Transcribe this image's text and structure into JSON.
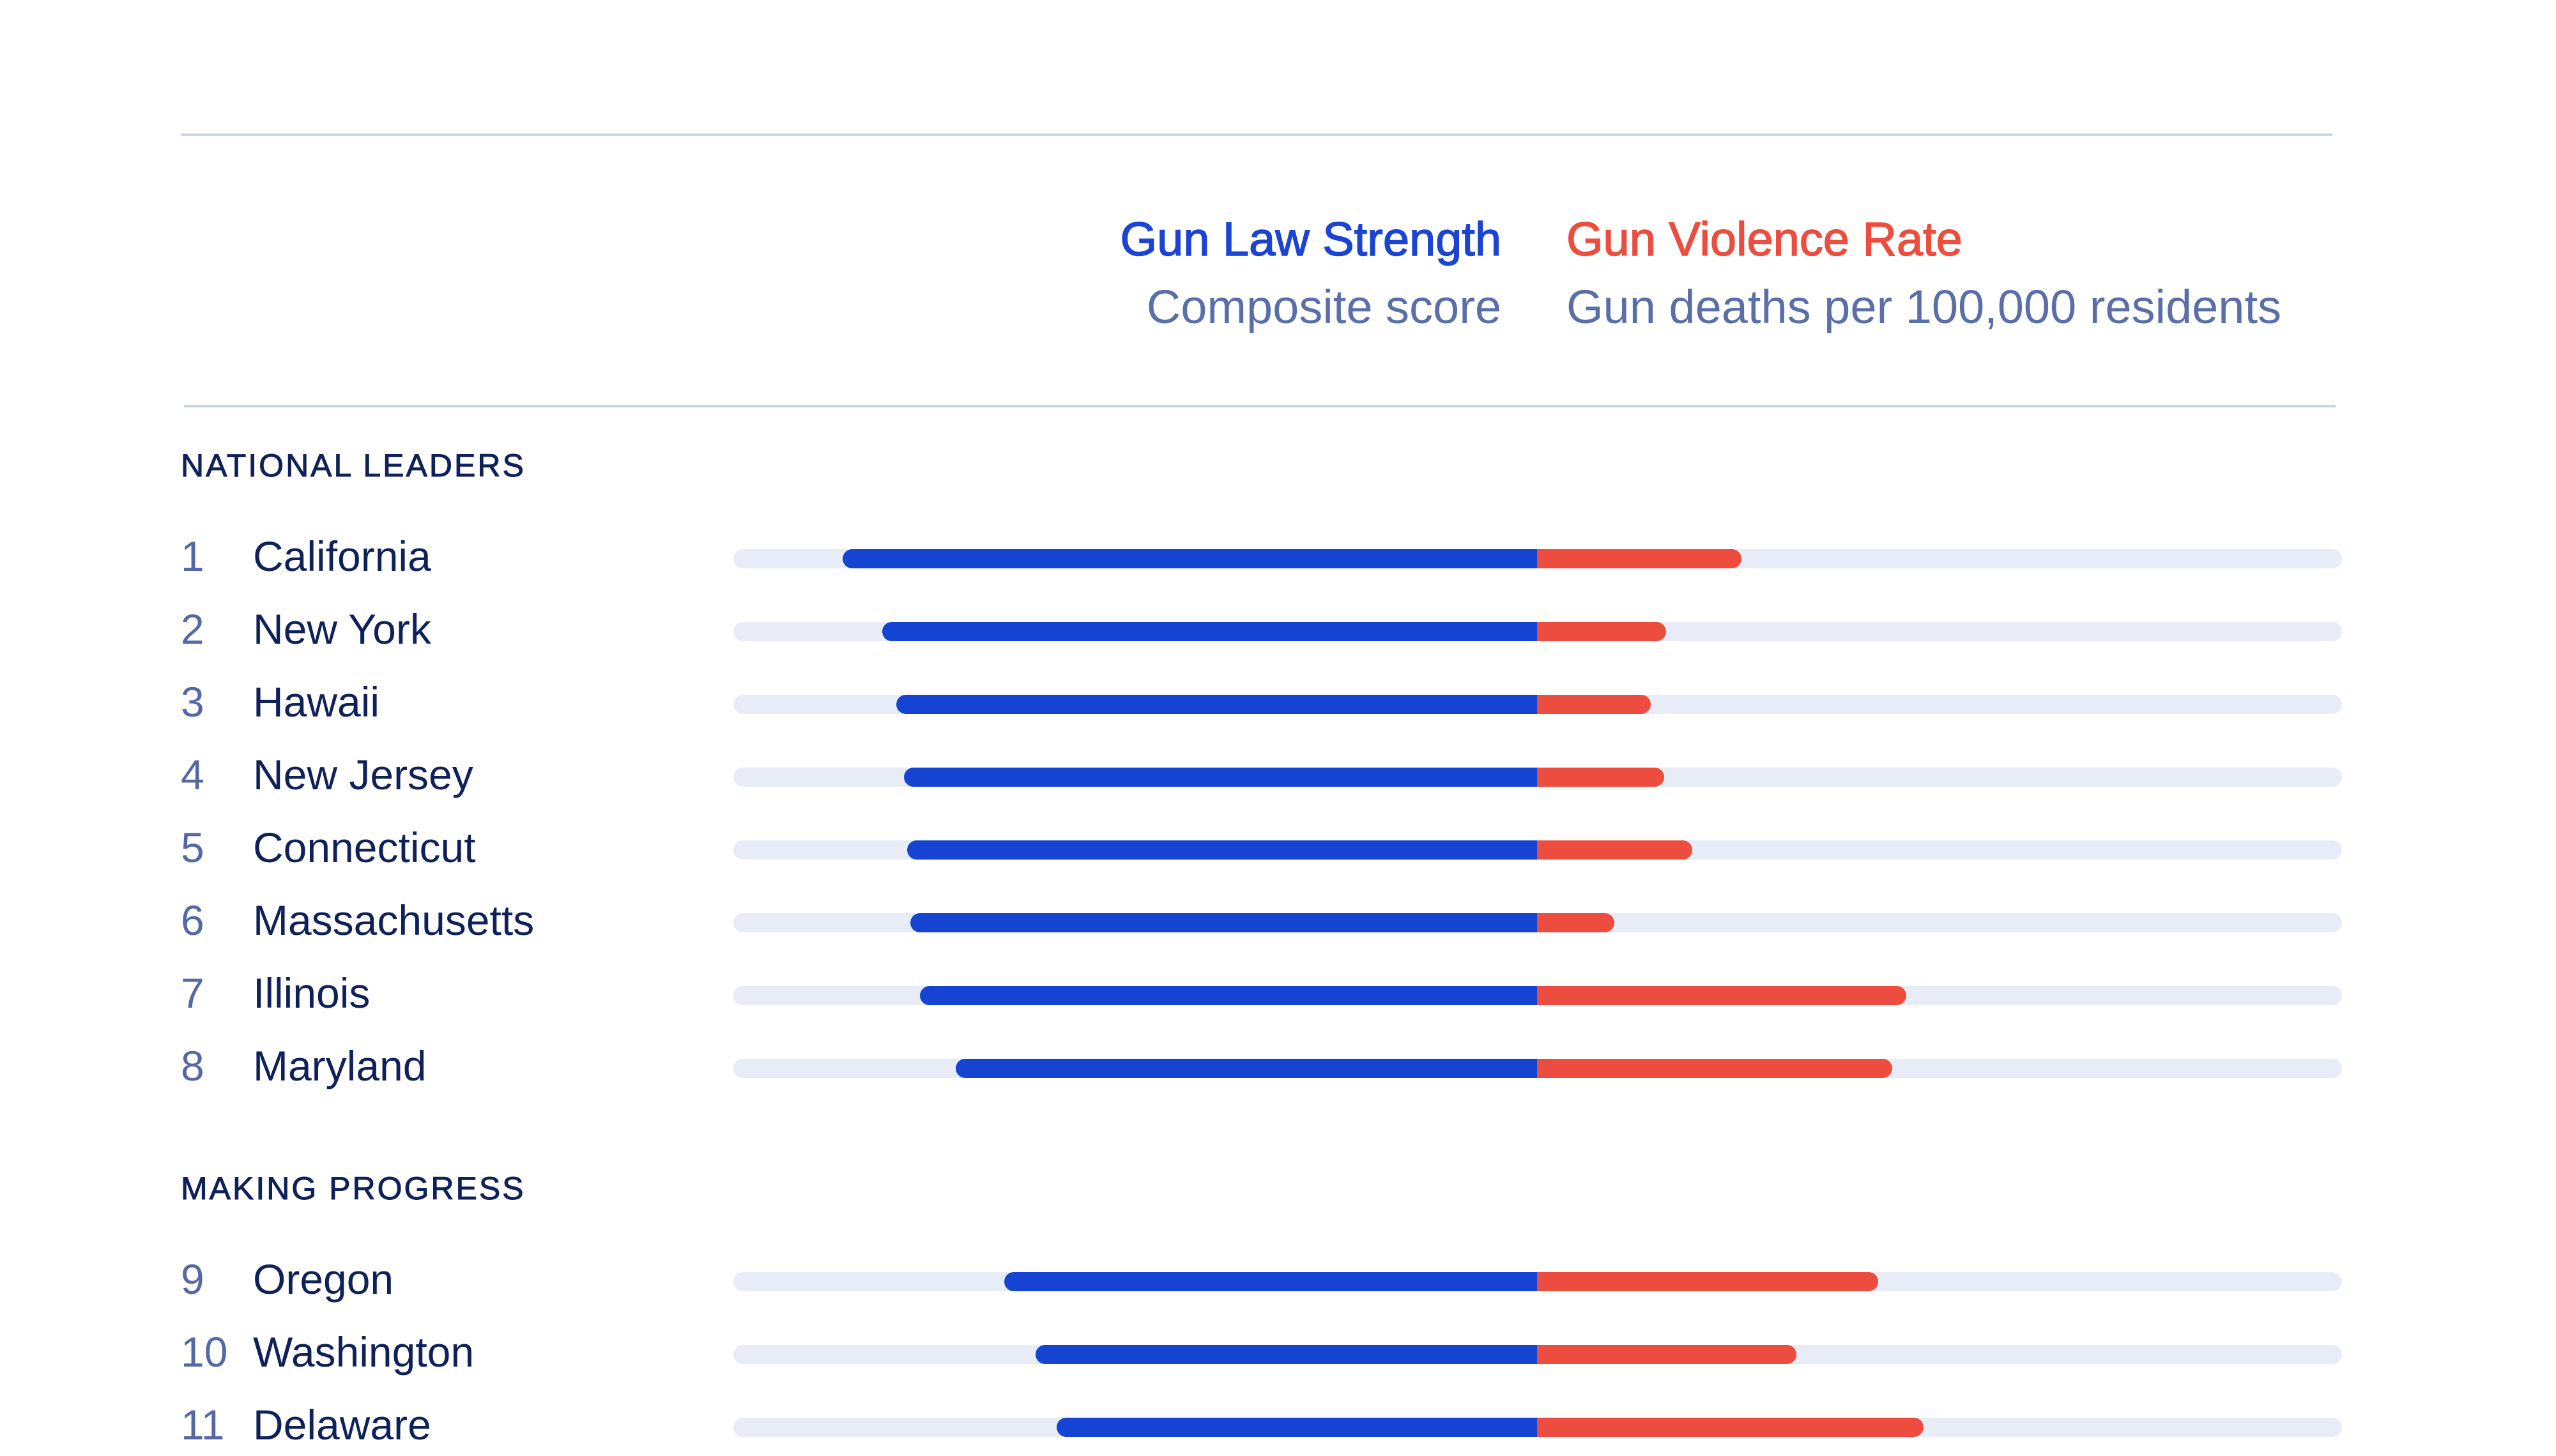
{
  "chart_data": {
    "type": "bar",
    "orientation": "horizontal-diverging",
    "title": "",
    "series": [
      {
        "name": "Gun Law Strength",
        "subtitle": "Composite score",
        "color": "#1544d3",
        "direction": "left",
        "values": [
          0.864,
          0.815,
          0.797,
          0.788,
          0.784,
          0.78,
          0.768,
          0.723,
          0.663,
          0.624,
          0.598
        ],
        "unit": "fraction of max (estimated, no axis shown)"
      },
      {
        "name": "Gun Violence Rate",
        "subtitle": "Gun deaths per 100,000 residents",
        "color": "#ec4d3e",
        "direction": "right",
        "values": [
          0.254,
          0.16,
          0.141,
          0.158,
          0.193,
          0.096,
          0.459,
          0.441,
          0.424,
          0.322,
          0.48
        ],
        "unit": "fraction of max (estimated, no axis shown)"
      }
    ],
    "groups": [
      {
        "label": "NATIONAL LEADERS",
        "rows": [
          {
            "rank": "1",
            "state": "California"
          },
          {
            "rank": "2",
            "state": "New York"
          },
          {
            "rank": "3",
            "state": "Hawaii"
          },
          {
            "rank": "4",
            "state": "New Jersey"
          },
          {
            "rank": "5",
            "state": "Connecticut"
          },
          {
            "rank": "6",
            "state": "Massachusetts"
          },
          {
            "rank": "7",
            "state": "Illinois"
          },
          {
            "rank": "8",
            "state": "Maryland"
          }
        ]
      },
      {
        "label": "MAKING PROGRESS",
        "rows": [
          {
            "rank": "9",
            "state": "Oregon"
          },
          {
            "rank": "10",
            "state": "Washington"
          },
          {
            "rank": "11",
            "state": "Delaware"
          }
        ]
      }
    ],
    "xlabel": "",
    "ylabel": "",
    "grid": false,
    "legend": "top-center"
  },
  "header": {
    "left_title": "Gun Law Strength",
    "left_subtitle": "Composite score",
    "right_title": "Gun Violence Rate",
    "right_subtitle": "Gun deaths per 100,000 residents"
  },
  "colors": {
    "law": "#1544d3",
    "violence": "#ec4d3e",
    "track": "#e8ecf6",
    "text": "#0f2159",
    "muted": "#5a6ea8"
  }
}
